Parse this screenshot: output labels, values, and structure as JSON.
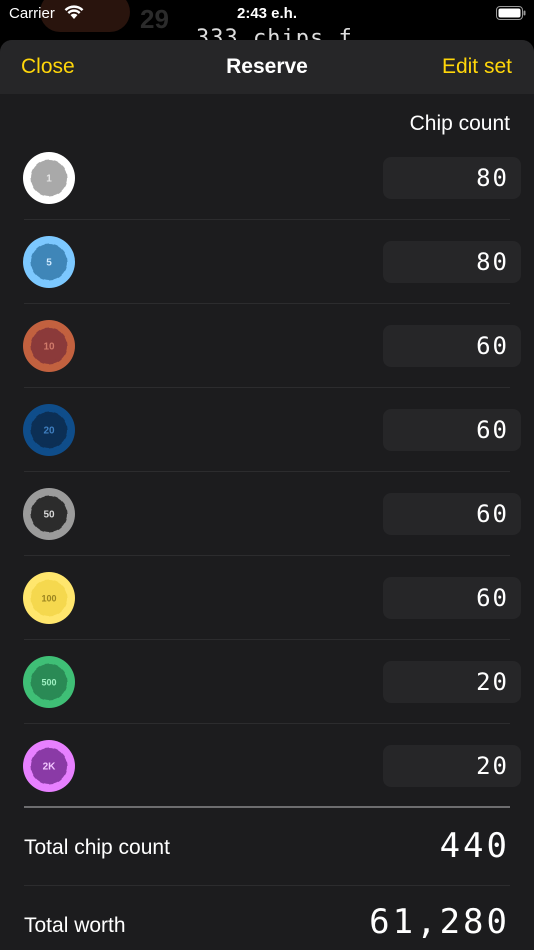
{
  "status_bar": {
    "carrier": "Carrier",
    "time": "2:43 e.h."
  },
  "background_peek": {
    "text1": "29",
    "text2": "333 chips f"
  },
  "nav": {
    "close_label": "Close",
    "title": "Reserve",
    "edit_label": "Edit set"
  },
  "column_header": "Chip count",
  "chips": [
    {
      "denomination": "1",
      "count": "80",
      "edge_color": "#ffffff",
      "face_color": "#a9a9a9",
      "text_color": "#e8e8e8"
    },
    {
      "denomination": "5",
      "count": "80",
      "edge_color": "#7cc8ff",
      "face_color": "#3f86b8",
      "text_color": "#cfeaff"
    },
    {
      "denomination": "10",
      "count": "60",
      "edge_color": "#c2613f",
      "face_color": "#8b3a3a",
      "text_color": "#d07a6a"
    },
    {
      "denomination": "20",
      "count": "60",
      "edge_color": "#0f4d8a",
      "face_color": "#0c2f55",
      "text_color": "#3f7fc0"
    },
    {
      "denomination": "50",
      "count": "60",
      "edge_color": "#9b9b9b",
      "face_color": "#2c2c2c",
      "text_color": "#d8d8d8"
    },
    {
      "denomination": "100",
      "count": "60",
      "edge_color": "#ffe66d",
      "face_color": "#f5d84e",
      "text_color": "#9a8420"
    },
    {
      "denomination": "500",
      "count": "20",
      "edge_color": "#3fbf76",
      "face_color": "#2a8a55",
      "text_color": "#9ff0c2"
    },
    {
      "denomination": "2K",
      "count": "20",
      "edge_color": "#e780ff",
      "face_color": "#8a3aa6",
      "text_color": "#f2c6ff"
    }
  ],
  "totals": {
    "chip_count_label": "Total chip count",
    "chip_count_value": "440",
    "worth_label": "Total worth",
    "worth_value": "61,280"
  },
  "accent_color": "#ffd60a"
}
